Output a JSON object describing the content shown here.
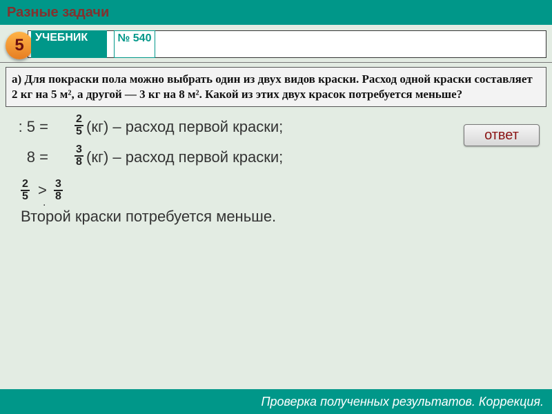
{
  "header": {
    "title": "Разные задачи"
  },
  "row2": {
    "badge": "5",
    "textbook": "УЧЕБНИК",
    "number": "№ 540"
  },
  "problem": {
    "text": "а) Для покраски пола можно выбрать один из двух видов краски. Расход одной краски составляет 2 кг на 5 м², а другой — 3 кг на 8 м². Какой из этих двух красок потребуется меньше?"
  },
  "work": {
    "line1": {
      "left": ": 5 =",
      "frac_num": "2",
      "frac_den": "5",
      "desc": "(кг) – расход первой краски;"
    },
    "line2": {
      "left": "8 =",
      "frac_num": "3",
      "frac_den": "8",
      "desc": "(кг) – расход первой краски;"
    },
    "cmp": {
      "a_num": "2",
      "a_den": "5",
      "op": ">",
      "b_num": "3",
      "b_den": "8",
      "dot": "."
    },
    "conclusion": "Второй краски потребуется меньше."
  },
  "answer_btn": "ответ",
  "footer": "Проверка полученных результатов. Коррекция."
}
